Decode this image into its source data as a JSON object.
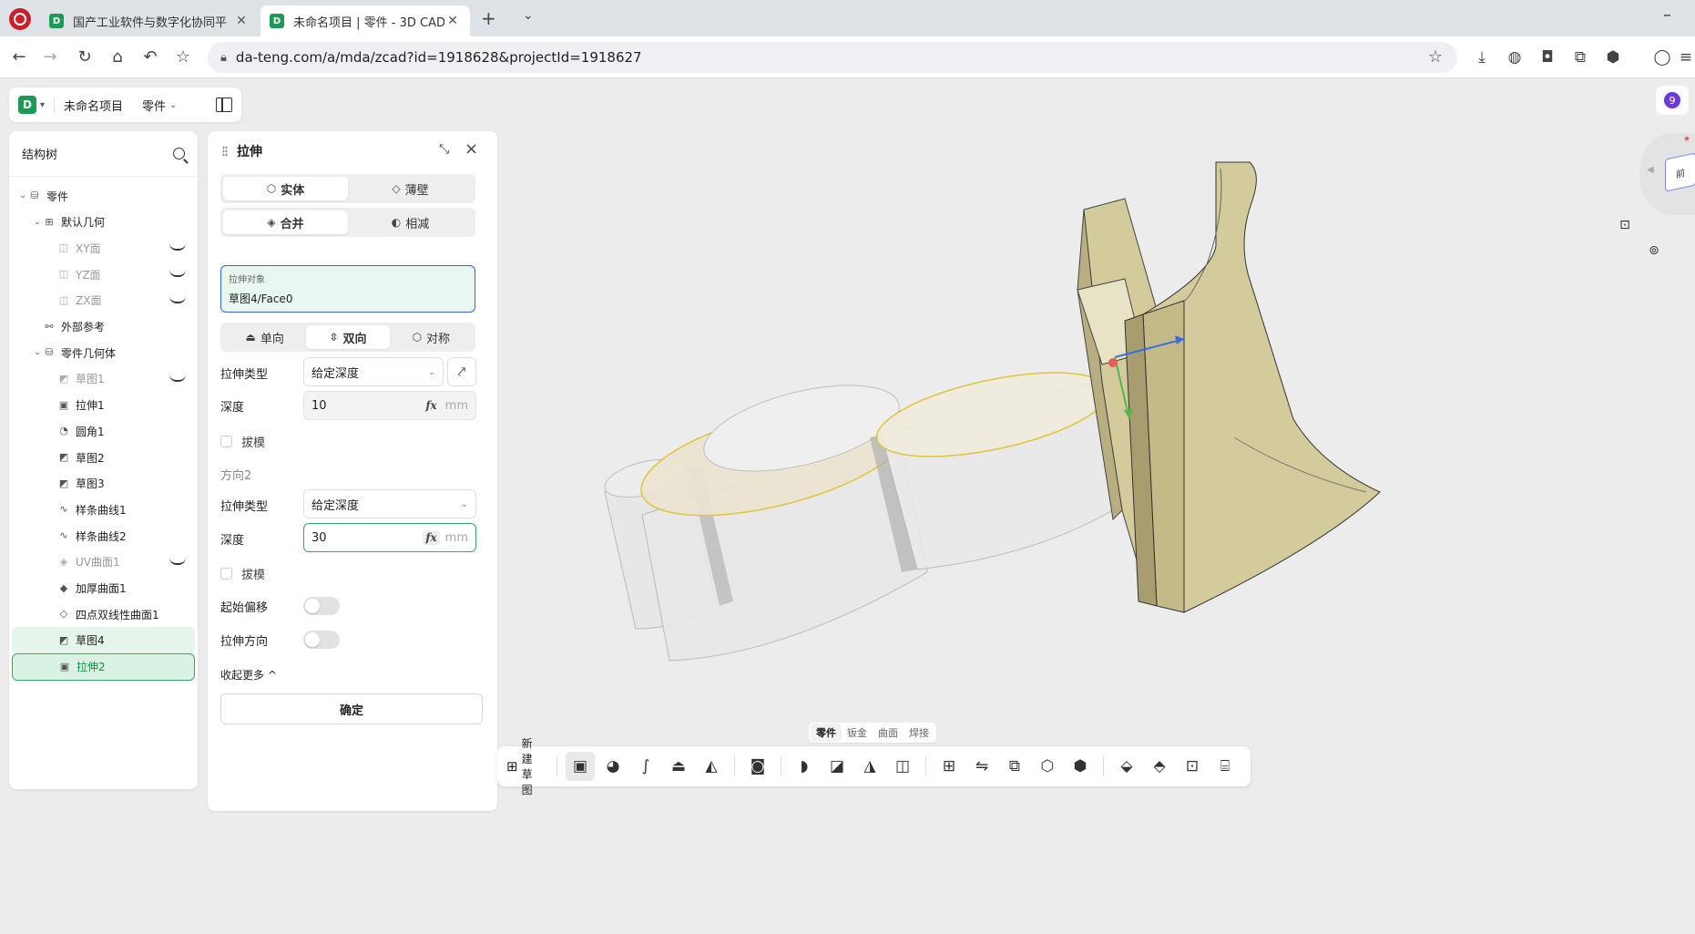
{
  "browser": {
    "tabs": [
      {
        "title": "国产工业软件与数字化协同平",
        "active": false
      },
      {
        "title": "未命名项目 | 零件 - 3D CAD",
        "active": true
      }
    ],
    "favicon_text": "D",
    "new_tab": "+",
    "tab_dropdown": "⌄",
    "minimize": "–",
    "close": "✕",
    "url": "da-teng.com/a/mda/zcad?id=1918628&projectId=1918627"
  },
  "app": {
    "logo": "D",
    "project_name": "未命名项目",
    "mode": "零件",
    "notification_count": "9",
    "cube_face": "前"
  },
  "tree": {
    "title": "结构树",
    "items": [
      {
        "label": "零件",
        "indent": 0,
        "caret": true,
        "icon": "part-icon",
        "glyph": "⛁"
      },
      {
        "label": "默认几何",
        "indent": 1,
        "caret": true,
        "icon": "default-geometry-icon",
        "glyph": "⊞"
      },
      {
        "label": "XY面",
        "indent": 2,
        "caret": false,
        "icon": "plane-icon",
        "glyph": "◫",
        "dim": true,
        "eye": true
      },
      {
        "label": "YZ面",
        "indent": 2,
        "caret": false,
        "icon": "plane-icon",
        "glyph": "◫",
        "dim": true,
        "eye": true
      },
      {
        "label": "ZX面",
        "indent": 2,
        "caret": false,
        "icon": "plane-icon",
        "glyph": "◫",
        "dim": true,
        "eye": true
      },
      {
        "label": "外部参考",
        "indent": 1,
        "caret": false,
        "icon": "external-reference-icon",
        "glyph": "⚯"
      },
      {
        "label": "零件几何体",
        "indent": 1,
        "caret": true,
        "icon": "part-body-icon",
        "glyph": "⛁"
      },
      {
        "label": "草图1",
        "indent": 2,
        "caret": false,
        "icon": "sketch-icon",
        "glyph": "◩",
        "dim": true,
        "eye": true
      },
      {
        "label": "拉伸1",
        "indent": 2,
        "caret": false,
        "icon": "extrude-icon",
        "glyph": "▣"
      },
      {
        "label": "圆角1",
        "indent": 2,
        "caret": false,
        "icon": "fillet-icon",
        "glyph": "◔"
      },
      {
        "label": "草图2",
        "indent": 2,
        "caret": false,
        "icon": "sketch-icon",
        "glyph": "◩"
      },
      {
        "label": "草图3",
        "indent": 2,
        "caret": false,
        "icon": "sketch-icon",
        "glyph": "◩"
      },
      {
        "label": "样条曲线1",
        "indent": 2,
        "caret": false,
        "icon": "spline-icon",
        "glyph": "∿"
      },
      {
        "label": "样条曲线2",
        "indent": 2,
        "caret": false,
        "icon": "spline-icon",
        "glyph": "∿"
      },
      {
        "label": "UV曲面1",
        "indent": 2,
        "caret": false,
        "icon": "uv-surface-icon",
        "glyph": "◈",
        "dim": true,
        "eye": true
      },
      {
        "label": "加厚曲面1",
        "indent": 2,
        "caret": false,
        "icon": "thicken-surface-icon",
        "glyph": "◆"
      },
      {
        "label": "四点双线性曲面1",
        "indent": 2,
        "caret": false,
        "icon": "bilinear-surface-icon",
        "glyph": "◇"
      },
      {
        "label": "草图4",
        "indent": 2,
        "caret": false,
        "icon": "sketch-icon",
        "glyph": "◩",
        "state": "soft"
      },
      {
        "label": "拉伸2",
        "indent": 2,
        "caret": false,
        "icon": "extrude-icon",
        "glyph": "▣",
        "state": "selected"
      }
    ]
  },
  "extrude": {
    "title": "拉伸",
    "solid": "实体",
    "thin": "薄壁",
    "merge": "合并",
    "subtract": "相减",
    "target_label": "拉伸对象",
    "target_value": "草图4/Face0",
    "one_way": "单向",
    "two_way": "双向",
    "symmetric": "对称",
    "type_label": "拉伸类型",
    "type_value": "给定深度",
    "depth_label": "深度",
    "depth1": "10",
    "unit": "mm",
    "fx": "fx",
    "draft": "拔模",
    "direction2": "方向2",
    "depth2": "30",
    "start_offset": "起始偏移",
    "extrude_direction": "拉伸方向",
    "collapse_more": "收起更多",
    "confirm": "确定"
  },
  "bottom": {
    "mode_tabs": [
      "零件",
      "钣金",
      "曲面",
      "焊接"
    ],
    "new_sketch": "新建草图",
    "tools": [
      {
        "name": "extrude-tool-icon",
        "glyph": "▣",
        "active": true
      },
      {
        "name": "revolve-tool-icon",
        "glyph": "◕"
      },
      {
        "name": "sweep-tool-icon",
        "glyph": "∫"
      },
      {
        "name": "loft-tool-icon",
        "glyph": "⏏"
      },
      {
        "name": "rib-tool-icon",
        "glyph": "◭"
      },
      {
        "name": "hole-tool-icon",
        "glyph": "◙"
      },
      {
        "name": "fillet-tool-icon",
        "glyph": "◗"
      },
      {
        "name": "chamfer-tool-icon",
        "glyph": "◪"
      },
      {
        "name": "draft-tool-icon",
        "glyph": "◮"
      },
      {
        "name": "shell-tool-icon",
        "glyph": "◫"
      },
      {
        "name": "pattern-tool-icon",
        "glyph": "⊞"
      },
      {
        "name": "mirror-tool-icon",
        "glyph": "⇋"
      },
      {
        "name": "move-body-tool-icon",
        "glyph": "⧉"
      },
      {
        "name": "combine-tool-icon",
        "glyph": "⬡"
      },
      {
        "name": "split-tool-icon",
        "glyph": "⬢"
      },
      {
        "name": "reference-plane-tool-icon",
        "glyph": "⬙"
      },
      {
        "name": "reference-axis-tool-icon",
        "glyph": "⬘"
      },
      {
        "name": "measure-tool-icon",
        "glyph": "⊡"
      },
      {
        "name": "material-tool-icon",
        "glyph": "⌸"
      }
    ]
  },
  "colors": {
    "accent": "#2fae62",
    "target_border": "#4161d6",
    "model_fill": "#d4cb9d",
    "preview_fill": "#e4e4e4",
    "preview_edge": "#e0c43a"
  }
}
